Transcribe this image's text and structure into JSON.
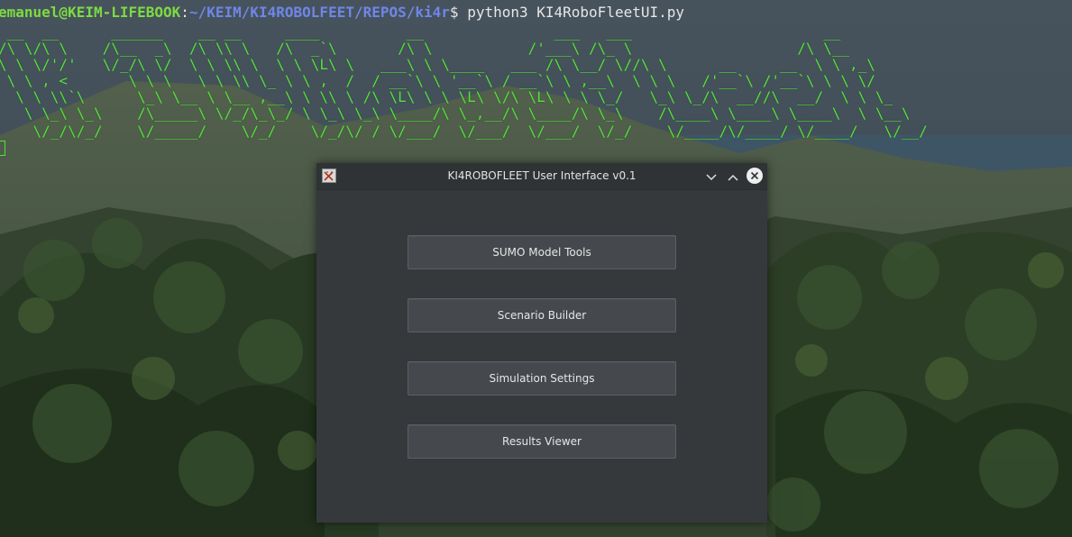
{
  "terminal": {
    "prompt_user": "emanuel@KEIM-LIFEBOOK",
    "prompt_sep": ":",
    "prompt_path": "~/KEIM/KI4ROBOLFEET/REPOS/ki4r",
    "prompt_dollar": "$ ",
    "command": "python3 KI4RoboFleetUI.py",
    "ascii_art": [
      " __  __      ______    __ __     ____          __               ___   ___                      __",
      "/\\ \\/\\ \\    /\\__  _\\  /\\ \\\\ \\   /\\  _`\\       /\\ \\           /'___\\ /\\_ \\                   /\\ \\__",
      "\\ \\ \\/'/'   \\/_/\\ \\/  \\ \\ \\\\ \\  \\ \\ \\L\\ \\   ___\\ \\ \\____   ___ /\\ \\__/ \\//\\ \\      __     __  \\ \\ ,_\\",
      " \\ \\ , <       \\ \\ \\   \\ \\ \\\\ \\_ \\ \\ ,  /  / __`\\ \\ '__`\\ / __`\\ \\ ,__\\  \\ \\ \\   /'__`\\ /'__`\\ \\ \\ \\/",
      "  \\ \\ \\\\`\\      \\_\\ \\__ \\ \\__ ,__\\ \\ \\\\ \\ /\\ \\L\\ \\ \\ \\L\\ \\/\\ \\L\\ \\ \\ \\_/   \\_\\ \\_/\\  __//\\  __/  \\ \\ \\_",
      "   \\ \\_\\ \\_\\    /\\_____\\ \\/_/\\_\\_/ \\ \\_\\ \\_\\ \\____/\\ \\_,__/\\ \\____/\\ \\_\\    /\\____\\ \\____\\ \\____\\  \\ \\__\\",
      "    \\/_/\\/_/    \\/_____/    \\/_/    \\/_/\\/ / \\/___/  \\/___/  \\/___/  \\/_/    \\/____/\\/____/ \\/____/   \\/__/"
    ]
  },
  "window": {
    "title": "KI4ROBOFLEET User Interface v0.1",
    "buttons": [
      {
        "label": "SUMO Model Tools"
      },
      {
        "label": "Scenario Builder"
      },
      {
        "label": "Simulation Settings"
      },
      {
        "label": "Results Viewer"
      }
    ]
  },
  "icons": {
    "app": "app-icon",
    "minimize": "chevron-down-icon",
    "maximize": "chevron-up-icon",
    "close": "close-icon"
  },
  "colors": {
    "ascii_green": "#52e33a",
    "prompt_user": "#7cdb43",
    "prompt_path": "#6f86e8",
    "window_bg": "#35393c",
    "button_bg": "#45494d"
  }
}
